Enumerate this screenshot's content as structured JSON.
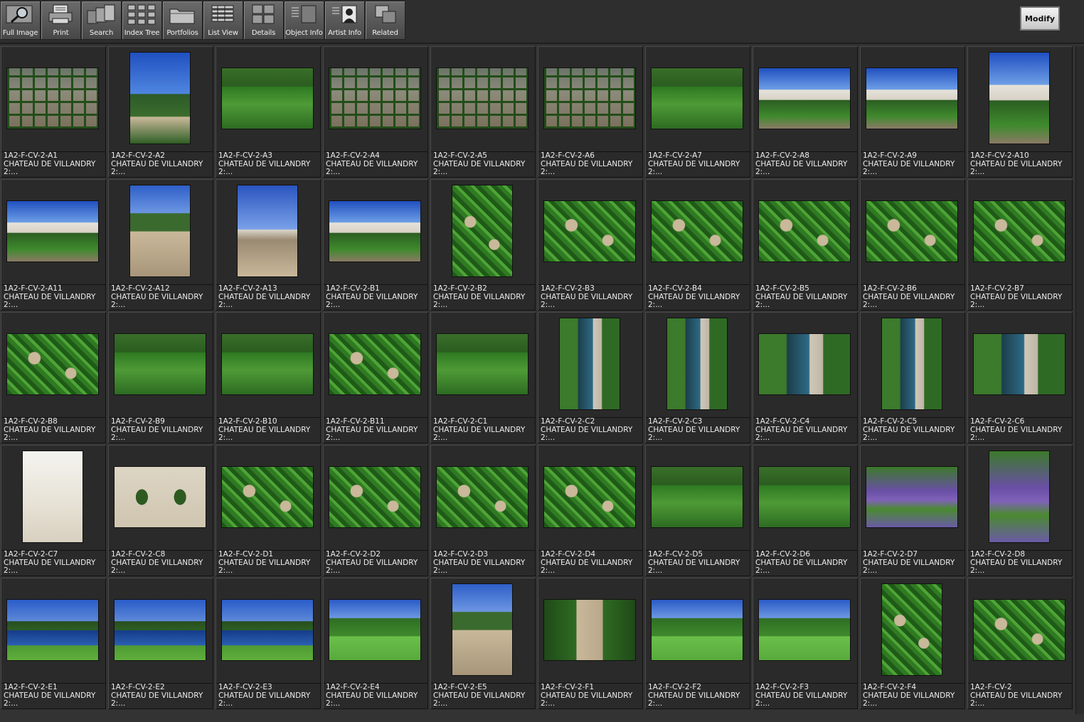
{
  "toolbar": {
    "buttons": [
      {
        "label": "Full Image",
        "icon": "magnifier-icon"
      },
      {
        "label": "Print",
        "icon": "printer-icon"
      },
      {
        "label": "Search",
        "icon": "search-stack-icon"
      },
      {
        "label": "Index Tree",
        "icon": "index-tree-icon"
      },
      {
        "label": "Portfolios",
        "icon": "folder-icon"
      },
      {
        "label": "List View",
        "icon": "list-view-icon"
      },
      {
        "label": "Details",
        "icon": "details-grid-icon"
      },
      {
        "label": "Object Info",
        "icon": "object-info-icon"
      },
      {
        "label": "Artist  Info",
        "icon": "artist-portrait-icon"
      },
      {
        "label": "Related",
        "icon": "related-squares-icon"
      }
    ],
    "modify_label": "Modify"
  },
  "colors": {
    "sky": "#2050c0",
    "hedge": "#2f7a22",
    "path": "#c9b89a",
    "background": "#333333"
  },
  "items": [
    {
      "id": "1A2-F-CV-2-A1",
      "title": "CHATEAU DE VILLANDRY",
      "desc": "2:..."
    },
    {
      "id": "1A2-F-CV-2-A2",
      "title": "CHATEAU DE VILLANDRY",
      "desc": "2:..."
    },
    {
      "id": "1A2-F-CV-2-A3",
      "title": "CHATEAU DE VILLANDRY",
      "desc": "2:..."
    },
    {
      "id": "1A2-F-CV-2-A4",
      "title": "CHATEAU DE VILLANDRY",
      "desc": "2:..."
    },
    {
      "id": "1A2-F-CV-2-A5",
      "title": "CHATEAU DE VILLANDRY",
      "desc": "2:..."
    },
    {
      "id": "1A2-F-CV-2-A6",
      "title": "CHATEAU DE VILLANDRY",
      "desc": "2:..."
    },
    {
      "id": "1A2-F-CV-2-A7",
      "title": "CHATEAU DE VILLANDRY",
      "desc": "2:..."
    },
    {
      "id": "1A2-F-CV-2-A8",
      "title": "CHATEAU DE VILLANDRY",
      "desc": "2:..."
    },
    {
      "id": "1A2-F-CV-2-A9",
      "title": "CHATEAU DE VILLANDRY",
      "desc": "2:..."
    },
    {
      "id": "1A2-F-CV-2-A10",
      "title": "CHATEAU DE VILLANDRY",
      "desc": "2:..."
    },
    {
      "id": "1A2-F-CV-2-A11",
      "title": "CHATEAU DE VILLANDRY",
      "desc": "2:..."
    },
    {
      "id": "1A2-F-CV-2-A12",
      "title": "CHATEAU DE VILLANDRY",
      "desc": "2:..."
    },
    {
      "id": "1A2-F-CV-2-A13",
      "title": "CHATEAU DE VILLANDRY",
      "desc": "2:..."
    },
    {
      "id": "1A2-F-CV-2-B1",
      "title": "CHATEAU DE VILLANDRY",
      "desc": "2:..."
    },
    {
      "id": "1A2-F-CV-2-B2",
      "title": "CHATEAU DE VILLANDRY",
      "desc": "2:..."
    },
    {
      "id": "1A2-F-CV-2-B3",
      "title": "CHATEAU DE VILLANDRY",
      "desc": "2:..."
    },
    {
      "id": "1A2-F-CV-2-B4",
      "title": "CHATEAU DE VILLANDRY",
      "desc": "2:..."
    },
    {
      "id": "1A2-F-CV-2-B5",
      "title": "CHATEAU DE VILLANDRY",
      "desc": "2:..."
    },
    {
      "id": "1A2-F-CV-2-B6",
      "title": "CHATEAU DE VILLANDRY",
      "desc": "2:..."
    },
    {
      "id": "1A2-F-CV-2-B7",
      "title": "CHATEAU DE VILLANDRY",
      "desc": "2:..."
    },
    {
      "id": "1A2-F-CV-2-B8",
      "title": "CHATEAU DE VILLANDRY",
      "desc": "2:..."
    },
    {
      "id": "1A2-F-CV-2-B9",
      "title": "CHATEAU DE VILLANDRY",
      "desc": "2:..."
    },
    {
      "id": "1A2-F-CV-2-B10",
      "title": "CHATEAU DE VILLANDRY",
      "desc": "2:..."
    },
    {
      "id": "1A2-F-CV-2-B11",
      "title": "CHATEAU DE VILLANDRY",
      "desc": "2:..."
    },
    {
      "id": "1A2-F-CV-2-C1",
      "title": "CHATEAU DE VILLANDRY",
      "desc": "2:..."
    },
    {
      "id": "1A2-F-CV-2-C2",
      "title": "CHATEAU DE VILLANDRY",
      "desc": "2:..."
    },
    {
      "id": "1A2-F-CV-2-C3",
      "title": "CHATEAU DE VILLANDRY",
      "desc": "2:..."
    },
    {
      "id": "1A2-F-CV-2-C4",
      "title": "CHATEAU DE VILLANDRY",
      "desc": "2:..."
    },
    {
      "id": "1A2-F-CV-2-C5",
      "title": "CHATEAU DE VILLANDRY",
      "desc": "2:..."
    },
    {
      "id": "1A2-F-CV-2-C6",
      "title": "CHATEAU DE VILLANDRY",
      "desc": "2:..."
    },
    {
      "id": "1A2-F-CV-2-C7",
      "title": "CHATEAU DE VILLANDRY",
      "desc": "2:..."
    },
    {
      "id": "1A2-F-CV-2-C8",
      "title": "CHATEAU DE VILLANDRY",
      "desc": "2:..."
    },
    {
      "id": "1A2-F-CV-2-D1",
      "title": "CHATEAU DE VILLANDRY",
      "desc": "2:..."
    },
    {
      "id": "1A2-F-CV-2-D2",
      "title": "CHATEAU DE VILLANDRY",
      "desc": "2:..."
    },
    {
      "id": "1A2-F-CV-2-D3",
      "title": "CHATEAU DE VILLANDRY",
      "desc": "2:..."
    },
    {
      "id": "1A2-F-CV-2-D4",
      "title": "CHATEAU DE VILLANDRY",
      "desc": "2:..."
    },
    {
      "id": "1A2-F-CV-2-D5",
      "title": "CHATEAU DE VILLANDRY",
      "desc": "2:..."
    },
    {
      "id": "1A2-F-CV-2-D6",
      "title": "CHATEAU DE VILLANDRY",
      "desc": "2:..."
    },
    {
      "id": "1A2-F-CV-2-D7",
      "title": "CHATEAU DE VILLANDRY",
      "desc": "2:..."
    },
    {
      "id": "1A2-F-CV-2-D8",
      "title": "CHATEAU DE VILLANDRY",
      "desc": "2:..."
    },
    {
      "id": "1A2-F-CV-2-E1",
      "title": "CHATEAU DE VILLANDRY",
      "desc": "2:..."
    },
    {
      "id": "1A2-F-CV-2-E2",
      "title": "CHATEAU DE VILLANDRY",
      "desc": "2:..."
    },
    {
      "id": "1A2-F-CV-2-E3",
      "title": "CHATEAU DE VILLANDRY",
      "desc": "2:..."
    },
    {
      "id": "1A2-F-CV-2-E4",
      "title": "CHATEAU DE VILLANDRY",
      "desc": "2:..."
    },
    {
      "id": "1A2-F-CV-2-E5",
      "title": "CHATEAU DE VILLANDRY",
      "desc": "2:..."
    },
    {
      "id": "1A2-F-CV-2-F1",
      "title": "CHATEAU DE VILLANDRY",
      "desc": "2:..."
    },
    {
      "id": "1A2-F-CV-2-F2",
      "title": "CHATEAU DE VILLANDRY",
      "desc": "2:..."
    },
    {
      "id": "1A2-F-CV-2-F3",
      "title": "CHATEAU DE VILLANDRY",
      "desc": "2:..."
    },
    {
      "id": "1A2-F-CV-2-F4",
      "title": "CHATEAU DE VILLANDRY",
      "desc": "2:..."
    },
    {
      "id": "1A2-F-CV-2",
      "title": "CHATEAU DE VILLANDRY",
      "desc": "2:..."
    }
  ]
}
